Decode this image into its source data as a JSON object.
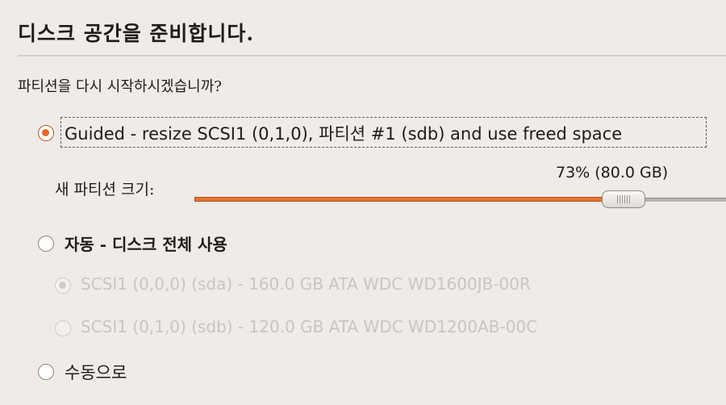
{
  "header": {
    "title": "디스크 공간을 준비합니다."
  },
  "question": "파티션을 다시 시작하시겠습니까?",
  "options": {
    "guided": {
      "label": "Guided - resize SCSI1 (0,1,0), 파티션 #1 (sdb) and use freed space",
      "selected": true
    },
    "new_partition_size": {
      "label": "새 파티션 크기:",
      "value_text": "73% (80.0 GB)",
      "percent": 73
    },
    "auto": {
      "label": "자동 - 디스크 전체 사용",
      "selected": false,
      "disks": [
        {
          "label": "SCSI1 (0,0,0) (sda) - 160.0 GB ATA WDC WD1600JB-00R",
          "selected": true,
          "enabled": false
        },
        {
          "label": "SCSI1 (0,1,0) (sdb) - 120.0 GB ATA WDC WD1200AB-00C",
          "selected": false,
          "enabled": false
        }
      ]
    },
    "manual": {
      "label": "수동으로",
      "selected": false
    }
  },
  "colors": {
    "accent": "#e5722f",
    "disabled_text": "#c9c5c0",
    "background": "#efebe7"
  }
}
